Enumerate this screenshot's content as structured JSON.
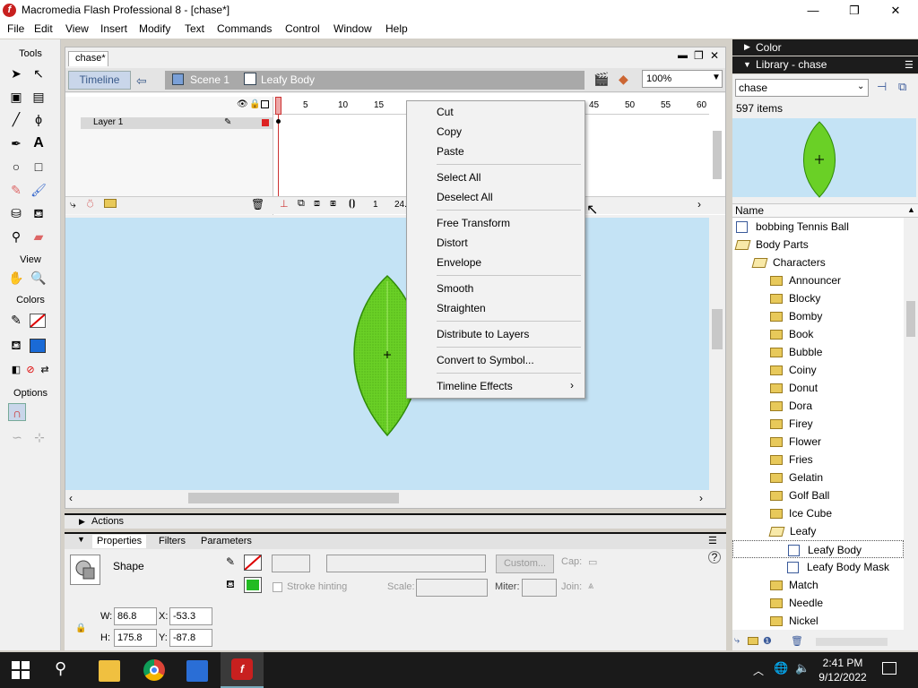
{
  "window": {
    "title": "Macromedia Flash Professional 8 - [chase*]",
    "logo": "flash-logo",
    "minimize": "—",
    "restore": "❐",
    "close": "✕"
  },
  "menubar": [
    "File",
    "Edit",
    "View",
    "Insert",
    "Modify",
    "Text",
    "Commands",
    "Control",
    "Window",
    "Help"
  ],
  "tools": {
    "title": "Tools",
    "view_label": "View",
    "colors_label": "Colors",
    "options_label": "Options"
  },
  "document": {
    "tab": "chase*",
    "timeline_button": "Timeline",
    "scene": "Scene 1",
    "symbol": "Leafy Body",
    "zoom": "100%",
    "layer_name": "Layer 1",
    "ruler_ticks": [
      "5",
      "10",
      "15",
      "45",
      "50",
      "55",
      "60"
    ],
    "current_frame": "1",
    "fps": "24.",
    "shape_color": "#66cc22"
  },
  "context_menu": {
    "groups": [
      [
        "Cut",
        "Copy",
        "Paste"
      ],
      [
        "Select All",
        "Deselect All"
      ],
      [
        "Free Transform",
        "Distort",
        "Envelope"
      ],
      [
        "Smooth",
        "Straighten"
      ],
      [
        "Distribute to Layers"
      ],
      [
        "Convert to Symbol..."
      ],
      [
        "Timeline Effects"
      ]
    ]
  },
  "panels": {
    "actions": "Actions",
    "tabs": [
      "Properties",
      "Filters",
      "Parameters"
    ],
    "shape_label": "Shape",
    "stroke_hinting": "Stroke hinting",
    "custom": "Custom...",
    "cap": "Cap:",
    "scale": "Scale:",
    "miter": "Miter:",
    "join": "Join:",
    "w_label": "W:",
    "w": "86.8",
    "h_label": "H:",
    "h": "175.8",
    "x_label": "X:",
    "x": "-53.3",
    "y_label": "Y:",
    "y": "-87.8"
  },
  "color_panel": {
    "title": "Color"
  },
  "library": {
    "title": "Library - chase",
    "selected": "chase",
    "count": "597 items",
    "col_header": "Name",
    "items": [
      {
        "label": "bobbing Tennis Ball",
        "type": "symbol",
        "depth": 0
      },
      {
        "label": "Body Parts",
        "type": "folder-open",
        "depth": 0
      },
      {
        "label": "Characters",
        "type": "folder-open",
        "depth": 1
      },
      {
        "label": "Announcer",
        "type": "folder",
        "depth": 2
      },
      {
        "label": "Blocky",
        "type": "folder",
        "depth": 2
      },
      {
        "label": "Bomby",
        "type": "folder",
        "depth": 2
      },
      {
        "label": "Book",
        "type": "folder",
        "depth": 2
      },
      {
        "label": "Bubble",
        "type": "folder",
        "depth": 2
      },
      {
        "label": "Coiny",
        "type": "folder",
        "depth": 2
      },
      {
        "label": "Donut",
        "type": "folder",
        "depth": 2
      },
      {
        "label": "Dora",
        "type": "folder",
        "depth": 2
      },
      {
        "label": "Firey",
        "type": "folder",
        "depth": 2
      },
      {
        "label": "Flower",
        "type": "folder",
        "depth": 2
      },
      {
        "label": "Fries",
        "type": "folder",
        "depth": 2
      },
      {
        "label": "Gelatin",
        "type": "folder",
        "depth": 2
      },
      {
        "label": "Golf Ball",
        "type": "folder",
        "depth": 2
      },
      {
        "label": "Ice Cube",
        "type": "folder",
        "depth": 2
      },
      {
        "label": "Leafy",
        "type": "folder-open",
        "depth": 2
      },
      {
        "label": "Leafy Body",
        "type": "symbol",
        "depth": 3,
        "selected": true
      },
      {
        "label": "Leafy Body Mask",
        "type": "symbol",
        "depth": 3
      },
      {
        "label": "Match",
        "type": "folder",
        "depth": 2
      },
      {
        "label": "Needle",
        "type": "folder",
        "depth": 2
      },
      {
        "label": "Nickel",
        "type": "folder",
        "depth": 2
      }
    ]
  },
  "taskbar": {
    "time": "2:41 PM",
    "date": "9/12/2022"
  }
}
